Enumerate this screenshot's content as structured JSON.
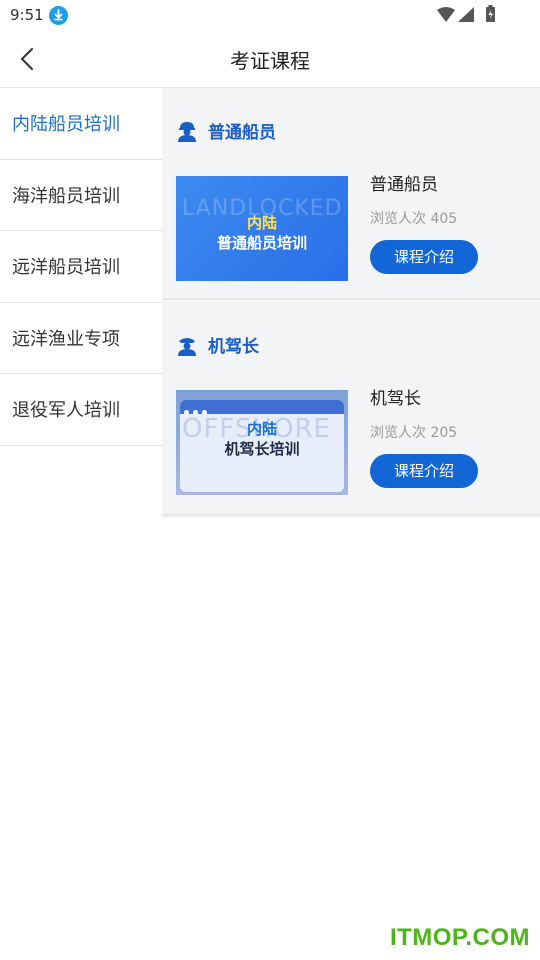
{
  "status_bar": {
    "time": "9:51"
  },
  "header": {
    "title": "考证课程"
  },
  "sidebar": {
    "items": [
      {
        "label": "内陆船员培训"
      },
      {
        "label": "海洋船员培训"
      },
      {
        "label": "远洋船员培训"
      },
      {
        "label": "远洋渔业专项"
      },
      {
        "label": "退役军人培训"
      }
    ]
  },
  "sections": [
    {
      "title": "普通船员",
      "icon": "worker-icon",
      "thumb": {
        "watermark": "LANDLOCKED",
        "line1": "内陆",
        "line2": "普通船员培训"
      },
      "card": {
        "title": "普通船员",
        "views": "浏览人次 405",
        "button": "课程介绍"
      }
    },
    {
      "title": "机驾长",
      "icon": "captain-icon",
      "thumb": {
        "watermark": "OFFSHORE",
        "line1": "内陆",
        "line2": "机驾长培训"
      },
      "card": {
        "title": "机驾长",
        "views": "浏览人次 205",
        "button": "课程介绍"
      }
    }
  ],
  "colors": {
    "accent": "#1266d6",
    "active_text": "#1a6fd0",
    "watermark_green": "#4cb51a"
  },
  "watermark": "ITMOP.COM"
}
